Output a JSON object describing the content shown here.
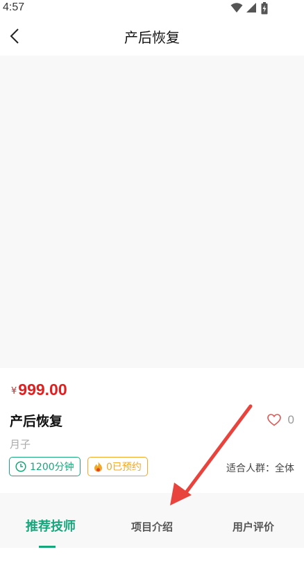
{
  "status_bar": {
    "time": "4:57"
  },
  "nav": {
    "title": "产后恢复"
  },
  "product": {
    "price_symbol": "¥",
    "price": "999.00",
    "name": "产后恢复",
    "favorite_count": "0",
    "category": "月子",
    "duration": "1200分钟",
    "bookings": "0已预约",
    "audience": "适合人群：全体"
  },
  "tabs": [
    {
      "label": "推荐技师",
      "active": true
    },
    {
      "label": "项目介绍",
      "active": false
    },
    {
      "label": "用户评价",
      "active": false
    }
  ],
  "colors": {
    "accent": "#17a67c",
    "price": "#e02020",
    "booking": "#f0a928",
    "annotation": "#e8433c"
  }
}
